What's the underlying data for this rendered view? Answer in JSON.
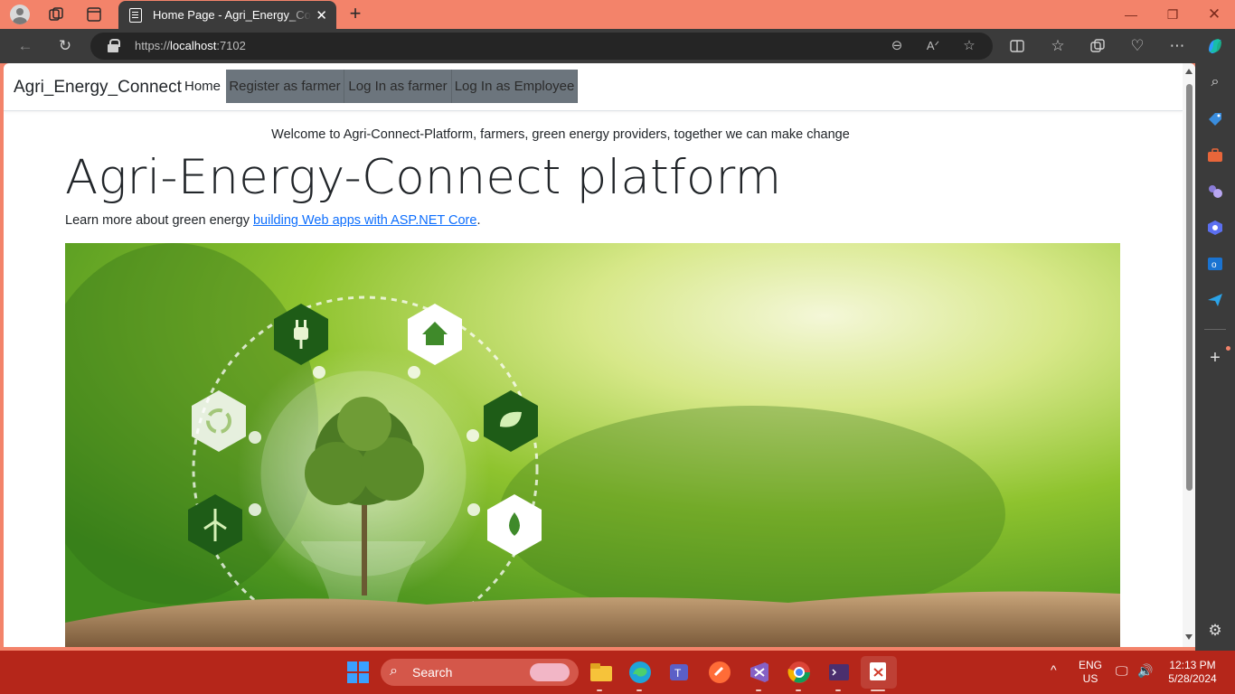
{
  "browser": {
    "tab_title": "Home Page - Agri_Energy_Connect",
    "url_scheme": "https://",
    "url_host": "localhost",
    "url_port": ":7102"
  },
  "page": {
    "brand": "Agri_Energy_Connect",
    "nav": {
      "home": "Home",
      "register_farmer": "Register as farmer",
      "login_farmer": "Log In as farmer",
      "login_employee": "Log In as Employee"
    },
    "welcome": "Welcome to Agri-Connect-Platform, farmers, green energy providers, together we can make change",
    "heading": "Agri-Energy-Connect platform",
    "learn_prefix": "Learn more about green energy ",
    "learn_link": "building Web apps with ASP.NET Core",
    "learn_suffix": ".",
    "hero_icons": [
      "plug-icon",
      "house-icon",
      "recycle-icon",
      "leaf-icon",
      "wind-turbine-icon",
      "water-drop-icon"
    ]
  },
  "taskbar": {
    "search_label": "Search",
    "lang_line1": "ENG",
    "lang_line2": "US",
    "time": "12:13 PM",
    "date": "5/28/2024"
  },
  "colors": {
    "titlebar": "#f3836a",
    "taskbar": "#b5261a",
    "nav_button": "#6c757d",
    "link": "#0d6efd"
  }
}
